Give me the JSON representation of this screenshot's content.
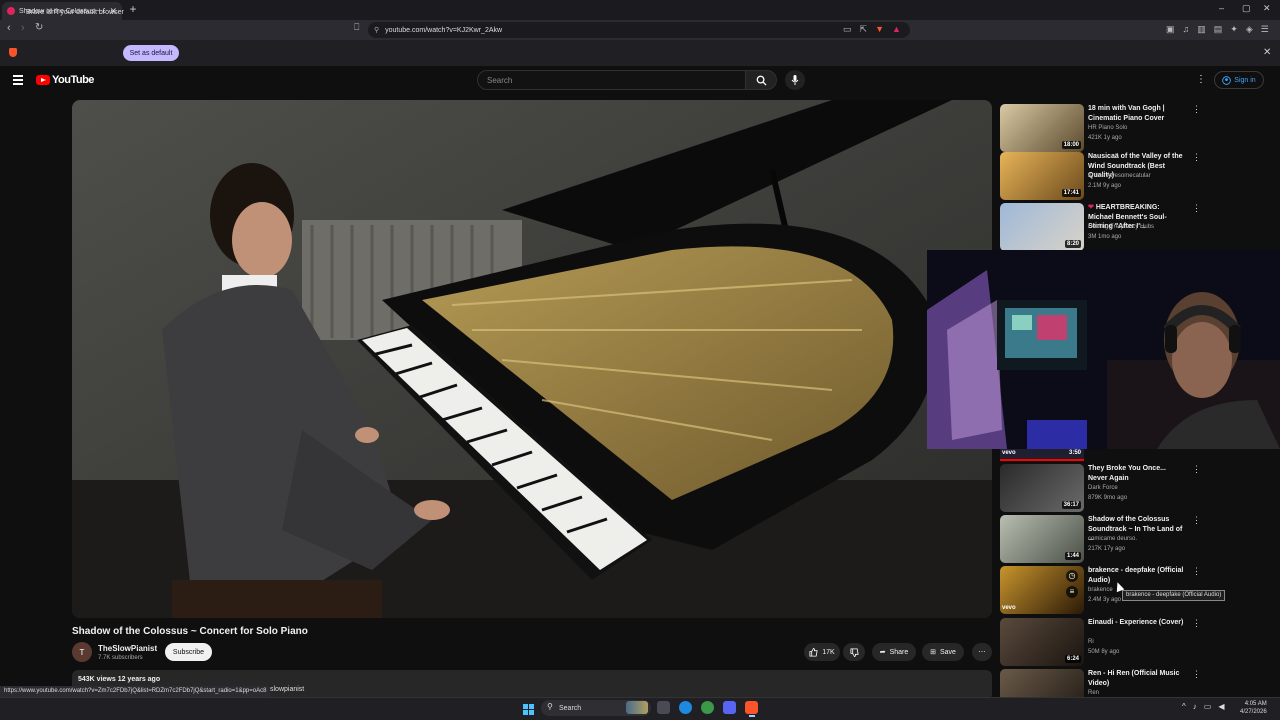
{
  "browser": {
    "tab_title": "Shadow of the Colossus ~ Conc",
    "url": "youtube.com/watch?v=KJ2Kwr_2Akw",
    "infobar_text": "Brave isn't your default browser",
    "set_default_label": "Set as default"
  },
  "youtube": {
    "logo_text": "YouTube",
    "search_placeholder": "Search",
    "signin_label": "Sign in"
  },
  "video": {
    "title": "Shadow of the Colossus ~ Concert for Solo Piano",
    "avatar_letter": "T",
    "channel": "TheSlowPianist",
    "subscribers": "7.7K subscribers",
    "subscribe_label": "Subscribe",
    "likes": "17K",
    "share_label": "Share",
    "save_label": "Save",
    "views_date": "543K views  12 years ago"
  },
  "status": {
    "hover_url": "https://www.youtube.com/watch?v=Zm7c2FDb7jQ&list=RDZm7c2FDb7jQ&start_radio=1&pp=oAc8",
    "tail_text": "slowpianist"
  },
  "recommendations": [
    {
      "title": "18 min with Van Gogh | Cinematic Piano Cover",
      "channel": "HR Piano Solo",
      "meta": "421K  1y ago",
      "duration": "18:00"
    },
    {
      "title": "Nausicaä of the Valley of the Wind Soundtrack (Best Quality)",
      "channel": "Anime Awesomecatular",
      "meta": "2.1M  9y ago",
      "duration": "17:41"
    },
    {
      "title": "HEARTBREAKING: Michael Bennett's Soul-Stirring \"After I'...",
      "channel": "Healing Frequency Hubs",
      "meta": "3M  1mo ago",
      "duration": "8:20"
    },
    {
      "title": "They Broke You Once... Never Again",
      "channel": "Dark Force",
      "meta": "879K  9mo ago",
      "duration": "36:17"
    },
    {
      "title": "Shadow of the Colossus Soundtrack ~ In The Land of ...",
      "channel": "comicame deurso.",
      "meta": "217K  17y ago",
      "duration": "1:44"
    },
    {
      "title": "brakence - deepfake (Official Audio)",
      "channel": "brakence",
      "meta": "2.4M  3y ago",
      "duration": ""
    },
    {
      "title": "Einaudi - Experience (Cover)",
      "channel": "Ri",
      "meta": "50M  8y ago",
      "duration": "6:24"
    },
    {
      "title": "Ren - Hi Ren (Official Music Video)",
      "channel": "Ren",
      "meta": "",
      "duration": ""
    }
  ],
  "partial_rec_duration": "3:50",
  "tooltip": "brakence - deepfake (Official Audio)",
  "taskbar": {
    "search_label": "Search",
    "time": "4:05 AM",
    "date": "4/27/2026"
  },
  "colors": {
    "yt_red": "#ff0000",
    "set_default_bg": "#c4b8ff",
    "brave_orange": "#fb542b"
  }
}
